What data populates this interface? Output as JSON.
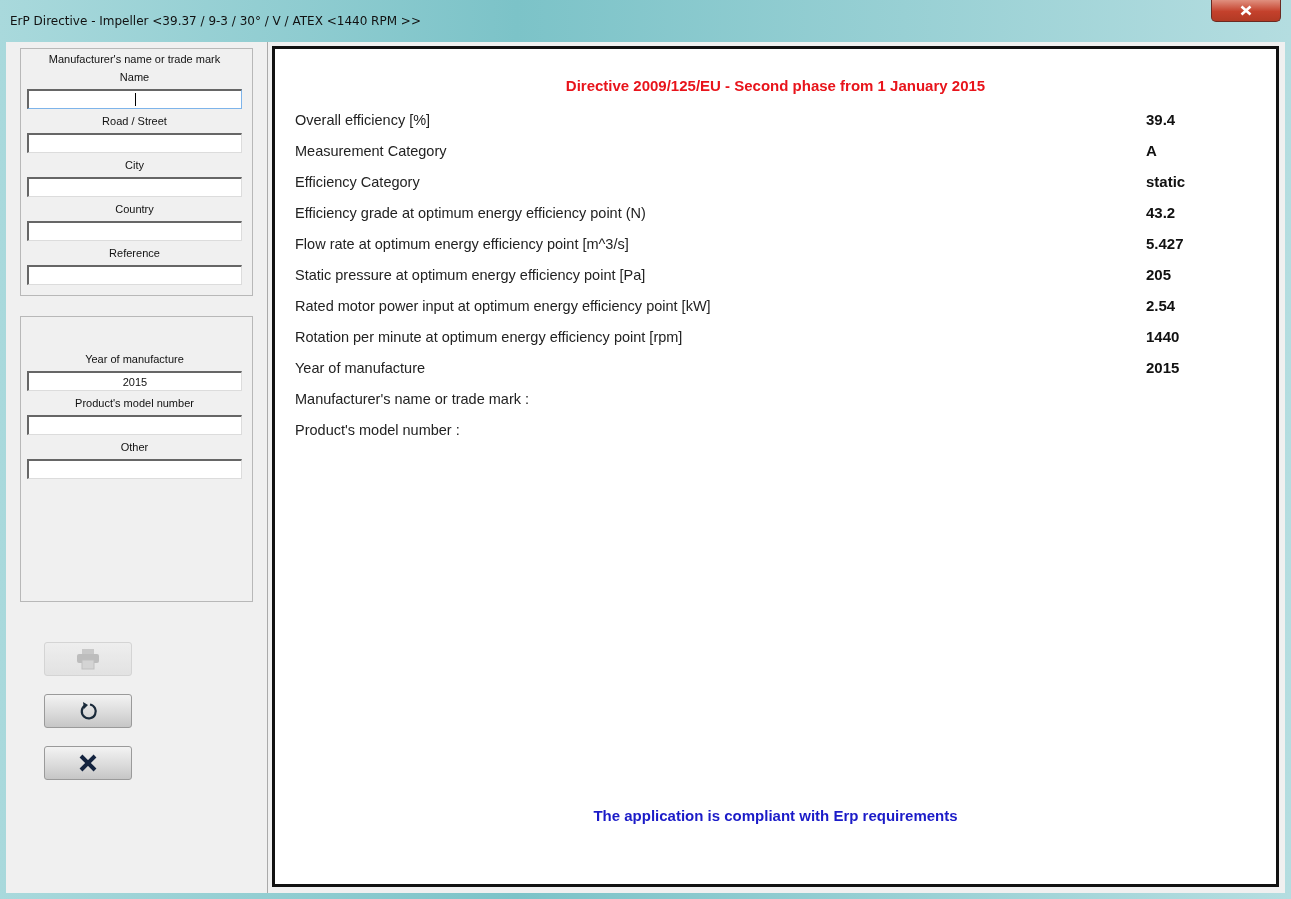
{
  "window": {
    "title": "ErP Directive - Impeller <39.37 / 9-3 / 30°  / V / ATEX <1440 RPM >>"
  },
  "sidebar": {
    "groups": [
      {
        "title": "Manufacturer's name or trade mark",
        "fields": [
          {
            "label": "Name",
            "focused": true
          },
          {
            "label": "Road / Street",
            "focused": false
          },
          {
            "label": "City",
            "focused": false
          },
          {
            "label": "Country",
            "focused": false
          },
          {
            "label": "Reference",
            "focused": false
          }
        ]
      },
      {
        "fields": [
          {
            "label": "Year of manufacture",
            "value": "2015",
            "focused": false
          },
          {
            "label": "Product's model number",
            "focused": false
          },
          {
            "label": "Other",
            "focused": false
          }
        ]
      }
    ],
    "buttons": [
      {
        "kind": "print",
        "disabled": true
      },
      {
        "kind": "reset",
        "disabled": false
      },
      {
        "kind": "close",
        "disabled": false
      }
    ]
  },
  "report": {
    "heading": "Directive 2009/125/EU - Second phase from 1 January 2015",
    "rows": [
      {
        "label": "Overall efficiency [%]",
        "value": "39.4"
      },
      {
        "label": "Measurement Category",
        "value": "A"
      },
      {
        "label": "Efficiency Category",
        "value": "static"
      },
      {
        "label": "Efficiency grade at optimum energy efficiency point (N)",
        "value": "43.2"
      },
      {
        "label": "Flow rate at optimum energy efficiency point [m^3/s]",
        "value": "5.427"
      },
      {
        "label": "Static pressure at optimum energy efficiency point [Pa]",
        "value": "205"
      },
      {
        "label": "Rated motor power input at optimum energy efficiency point [kW]",
        "value": "2.54"
      },
      {
        "label": "Rotation per minute at optimum energy efficiency point [rpm]",
        "value": "1440"
      },
      {
        "label": "Year of manufacture",
        "value": "2015"
      },
      {
        "label": "Manufacturer's name or trade mark :"
      },
      {
        "label": "Product's model number :"
      }
    ],
    "status": "The application is compliant with Erp requirements"
  }
}
